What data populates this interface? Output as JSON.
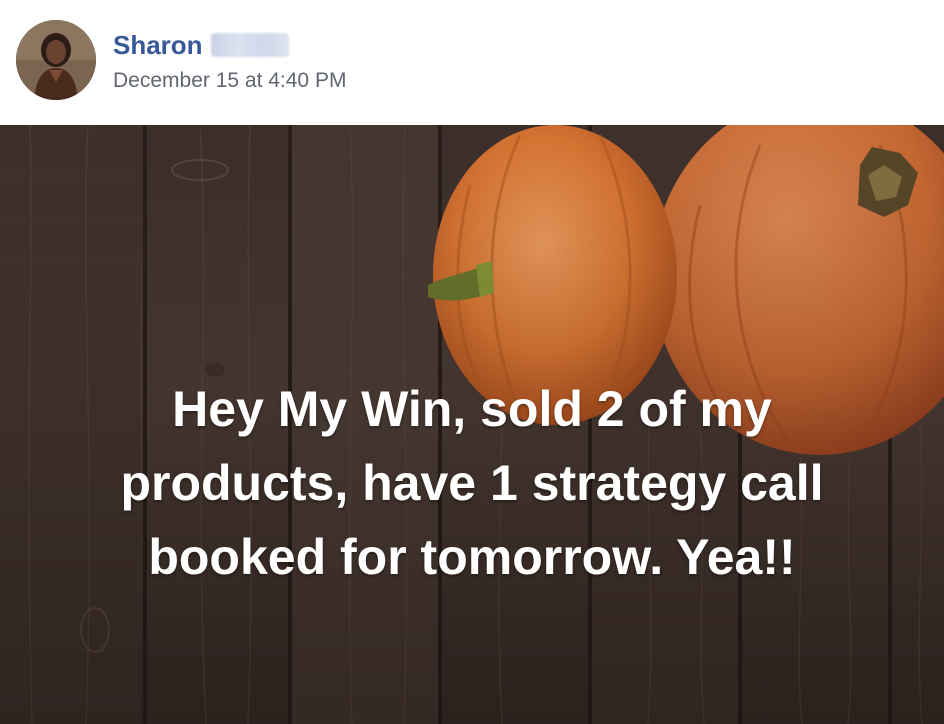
{
  "post": {
    "author": {
      "name": "Sharon"
    },
    "timestamp": "December 15 at 4:40 PM",
    "message_lines": [
      "Hey My Win, sold 2 of my",
      "products, have 1 strategy call",
      "booked for tomorrow. Yea!!"
    ]
  },
  "colors": {
    "author_link": "#385898",
    "timestamp": "#616770",
    "message_text": "#ffffff",
    "wood": "#4a3a33",
    "pumpkin": "#d8742e"
  }
}
